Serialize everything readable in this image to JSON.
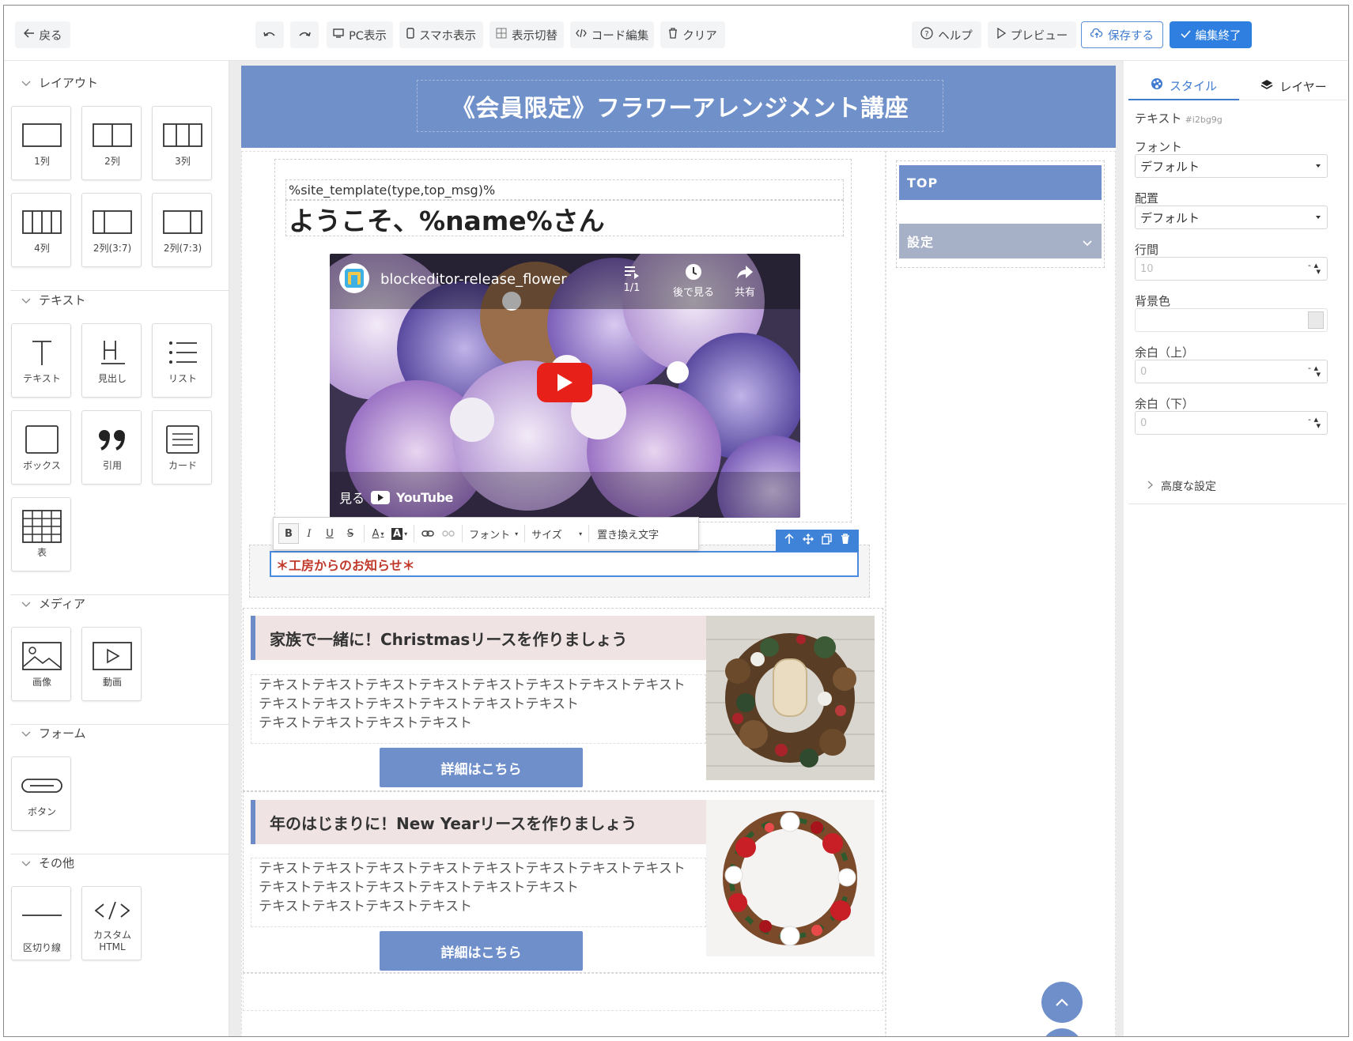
{
  "toolbar": {
    "back": "戻る",
    "pc_view": "PC表示",
    "sp_view": "スマホ表示",
    "toggle_view": "表示切替",
    "code_edit": "コード編集",
    "clear": "クリア",
    "help": "ヘルプ",
    "preview": "プレビュー",
    "save": "保存する",
    "finish": "編集終了"
  },
  "left": {
    "sections": {
      "layout": "レイアウト",
      "text": "テキスト",
      "media": "メディア",
      "form": "フォーム",
      "other": "その他"
    },
    "layout_items": [
      "1列",
      "2列",
      "3列",
      "4列",
      "2列(3:7)",
      "2列(7:3)"
    ],
    "text_items": [
      "テキスト",
      "見出し",
      "リスト",
      "ボックス",
      "引用",
      "カード",
      "表"
    ],
    "media_items": [
      "画像",
      "動画"
    ],
    "form_items": [
      "ボタン"
    ],
    "other_items": [
      "区切り線",
      "カスタム\nHTML"
    ]
  },
  "page": {
    "hero_title": "《会員限定》フラワーアレンジメント講座",
    "template_text": "%site_template(type,top_msg)%",
    "welcome": "ようこそ、%name%さん",
    "video": {
      "channel": "blockeditor-release_flower",
      "playlist_count": "1/1",
      "watch_later": "後で見る",
      "share": "共有",
      "watch_on": "見る",
      "youtube": "YouTube"
    },
    "rt_toolbar": {
      "bold": "B",
      "italic": "I",
      "underline": "U",
      "strike": "S",
      "text_color": "A",
      "bg_color": "A",
      "font": "フォント",
      "size": "サイズ",
      "replace": "置き換え文字"
    },
    "news": "＊工房からのお知らせ＊",
    "cards": [
      {
        "title": "家族で一緒に！Christmasリースを作りましょう",
        "lines": [
          "テキストテキストテキストテキストテキストテキストテキストテキスト",
          "テキストテキストテキストテキストテキストテキスト",
          "テキストテキストテキストテキスト"
        ],
        "button": "詳細はこちら"
      },
      {
        "title": "年のはじまりに！New Yearリースを作りましょう",
        "lines": [
          "テキストテキストテキストテキストテキストテキストテキストテキスト",
          "テキストテキストテキストテキストテキストテキスト",
          "テキストテキストテキストテキスト"
        ],
        "button": "詳細はこちら"
      }
    ],
    "side_nav": {
      "top": "TOP",
      "settings": "設定"
    }
  },
  "right": {
    "tab_style": "スタイル",
    "tab_layer": "レイヤー",
    "element_type": "テキスト",
    "element_id": "#i2bg9g",
    "font_label": "フォント",
    "font_value": "デフォルト",
    "align_label": "配置",
    "align_value": "デフォルト",
    "line_height_label": "行間",
    "line_height_placeholder": "10",
    "bg_label": "背景色",
    "margin_top_label": "余白（上）",
    "margin_top_placeholder": "0",
    "margin_bottom_label": "余白（下）",
    "margin_bottom_placeholder": "0",
    "advanced": "高度な設定"
  },
  "colors": {
    "accent": "#2f7fe0",
    "hero": "#7090c9",
    "card_button": "#6f8fcb",
    "news_text": "#c0392b"
  }
}
